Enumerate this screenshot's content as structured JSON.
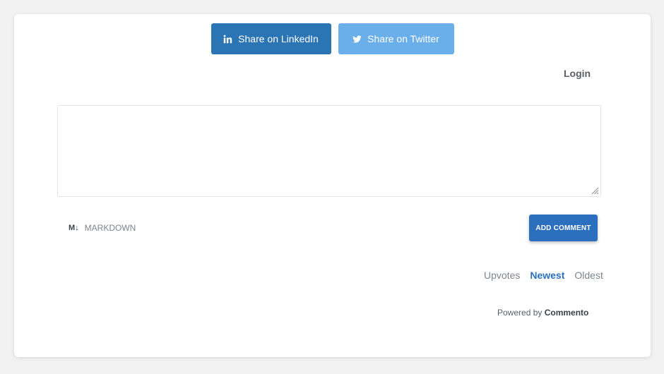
{
  "share": {
    "linkedin_label": "Share on LinkedIn",
    "twitter_label": "Share on Twitter",
    "linkedin_icon": "linkedin-icon",
    "twitter_icon": "twitter-icon"
  },
  "auth": {
    "login_label": "Login"
  },
  "editor": {
    "value": "",
    "markdown_icon_text": "M↓",
    "markdown_label": "MARKDOWN",
    "submit_label": "ADD COMMENT"
  },
  "sort": {
    "options": [
      "Upvotes",
      "Newest",
      "Oldest"
    ],
    "selected": "Newest"
  },
  "footer": {
    "powered_prefix": "Powered by",
    "brand": "Commento"
  },
  "colors": {
    "linkedin": "#2c75b4",
    "twitter": "#6aafea",
    "accent": "#2c6fbe",
    "text_muted": "#7d848c"
  }
}
